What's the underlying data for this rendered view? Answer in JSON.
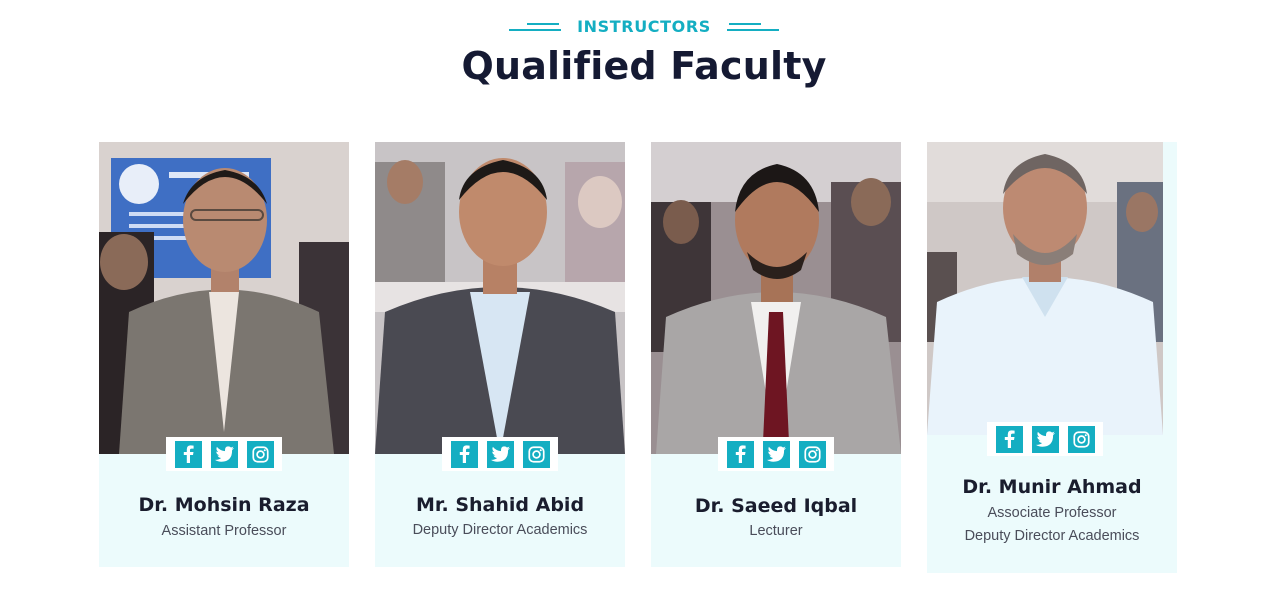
{
  "section": {
    "eyebrow": "INSTRUCTORS",
    "title": "Qualified Faculty",
    "accent_color": "#14aec2",
    "card_bg_color": "#ecfbfc"
  },
  "social_icons": [
    "facebook-icon",
    "twitter-icon",
    "instagram-icon"
  ],
  "faculty": [
    {
      "name": "Dr. Mohsin Raza",
      "roles": [
        "Assistant Professor"
      ]
    },
    {
      "name": "Mr. Shahid Abid",
      "roles": [
        "Deputy Director Academics"
      ]
    },
    {
      "name": "Dr. Saeed Iqbal",
      "roles": [
        "Lecturer"
      ]
    },
    {
      "name": "Dr. Munir Ahmad",
      "roles": [
        "Associate Professor",
        "Deputy Director Academics"
      ]
    }
  ]
}
